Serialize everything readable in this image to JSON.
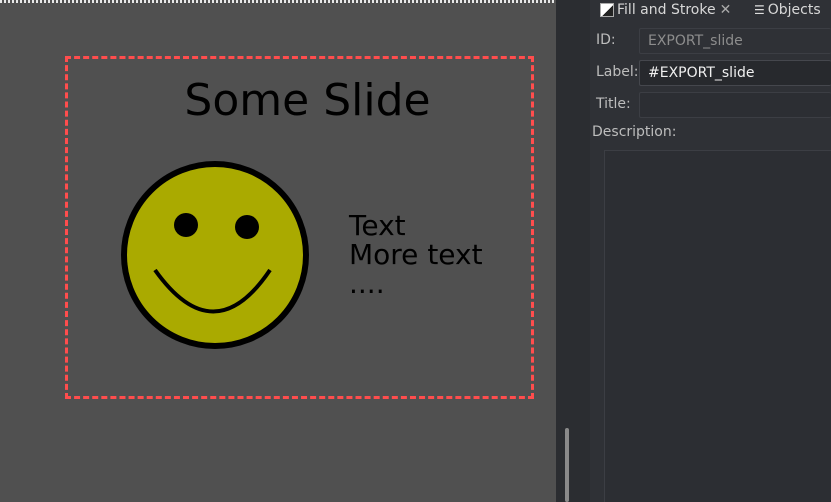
{
  "canvas": {
    "slide_title": "Some Slide",
    "slide_text_lines": [
      "Text",
      "More text",
      "...."
    ],
    "colors": {
      "frame": "#ff4d4d",
      "smiley_face": "#aaaa00",
      "canvas_bg": "#505050"
    }
  },
  "panel": {
    "tabs": [
      {
        "label": "Fill and Stroke",
        "icon": "fill-stroke-icon"
      },
      {
        "label": "Objects",
        "icon": "objects-icon"
      }
    ],
    "id_label": "ID:",
    "id_value": "EXPORT_slide",
    "label_label": "Label:",
    "label_value": "#EXPORT_slide",
    "title_label": "Title:",
    "title_value": "",
    "description_label": "Description:",
    "description_value": ""
  }
}
